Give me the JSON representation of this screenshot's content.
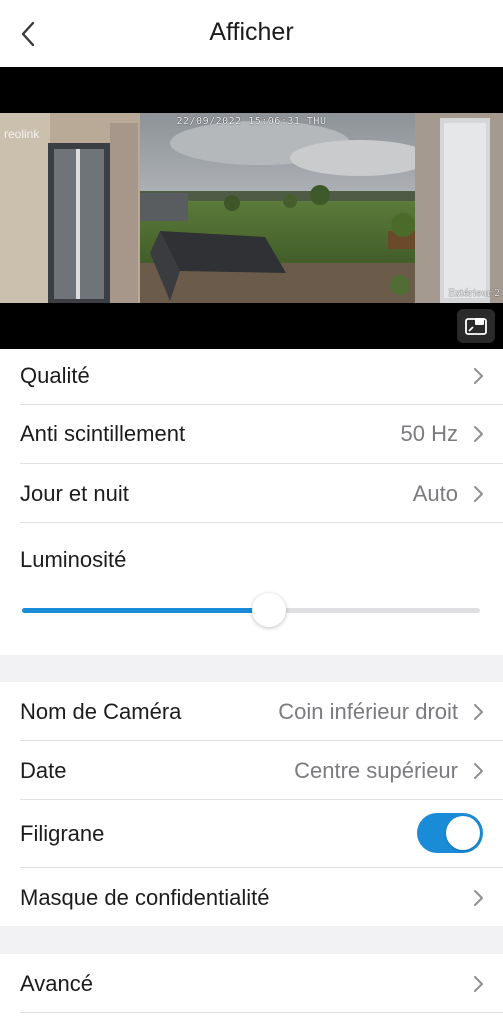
{
  "header": {
    "title": "Afficher"
  },
  "video": {
    "osd_date": "22/09/2022 15:06:31 THU",
    "osd_brand": "reolink",
    "osd_camera_name": "Extérieur 2"
  },
  "settings": {
    "quality": {
      "label": "Qualité"
    },
    "anti_flicker": {
      "label": "Anti scintillement",
      "value": "50 Hz"
    },
    "day_night": {
      "label": "Jour et nuit",
      "value": "Auto"
    },
    "brightness": {
      "label": "Luminosité",
      "level": 0.54
    },
    "camera_name": {
      "label": "Nom de Caméra",
      "value": "Coin inférieur droit"
    },
    "date": {
      "label": "Date",
      "value": "Centre supérieur"
    },
    "watermark": {
      "label": "Filigrane",
      "enabled": true
    },
    "privacy_mask": {
      "label": "Masque de confidentialité"
    },
    "advanced": {
      "label": "Avancé"
    }
  },
  "colors": {
    "accent": "#1a8bd6",
    "value_text": "#7b7b7f",
    "section_gap": "#f2f2f5"
  }
}
